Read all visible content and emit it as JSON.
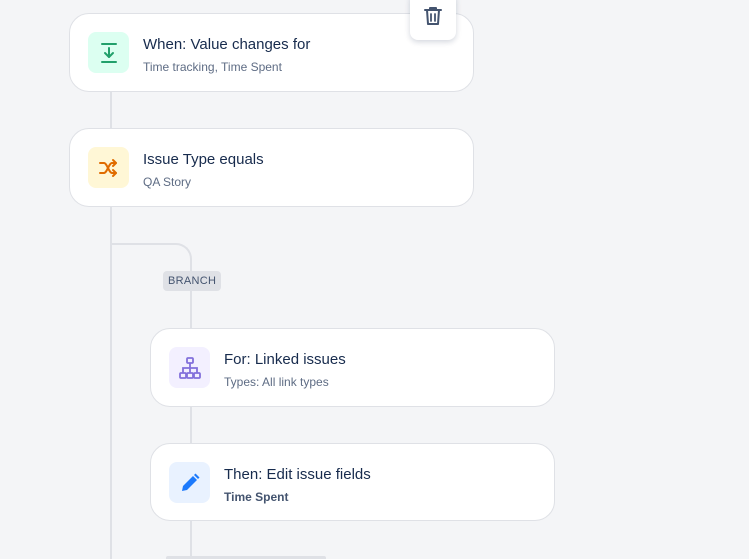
{
  "rule": {
    "trigger": {
      "title": "When: Value changes for",
      "subtitle": "Time tracking, Time Spent",
      "icon": "value-change-icon",
      "icon_bg": "#dcfff1",
      "icon_color": "#22a06b"
    },
    "condition": {
      "title": "Issue Type equals",
      "subtitle": "QA Story",
      "icon": "shuffle-icon",
      "icon_bg": "#fff7d6",
      "icon_color": "#e06c00"
    },
    "branch": {
      "label": "BRANCH",
      "for_step": {
        "title": "For: Linked issues",
        "subtitle": "Types: All link types",
        "icon": "hierarchy-icon",
        "icon_bg": "#f3f0ff",
        "icon_color": "#8270db"
      },
      "action": {
        "title": "Then: Edit issue fields",
        "subtitle": "Time Spent",
        "icon": "pencil-icon",
        "icon_bg": "#e9f2ff",
        "icon_color": "#1d7afc"
      }
    },
    "delete_button": {
      "icon": "trash-icon"
    }
  },
  "colors": {
    "canvas": "#f4f5f7",
    "connector": "#dfe1e6",
    "text_primary": "#172b4d",
    "text_secondary": "#5e6c84"
  }
}
